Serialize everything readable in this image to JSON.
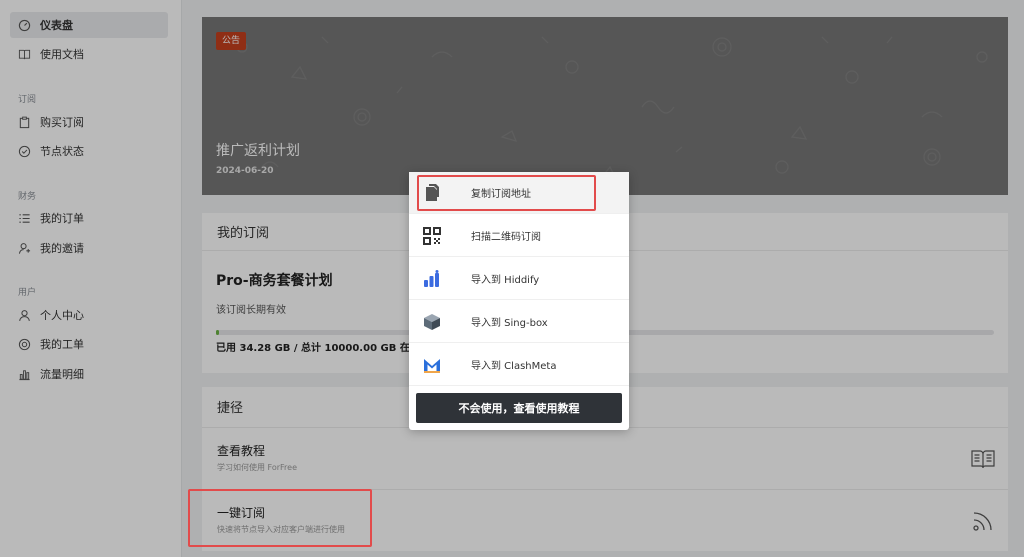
{
  "sidebar": {
    "items": [
      {
        "label": "仪表盘",
        "icon": "dashboard-icon"
      },
      {
        "label": "使用文档",
        "icon": "book-icon"
      },
      {
        "label": "购买订阅",
        "icon": "clipboard-icon"
      },
      {
        "label": "节点状态",
        "icon": "check-circle-icon"
      },
      {
        "label": "我的订单",
        "icon": "list-icon"
      },
      {
        "label": "我的邀请",
        "icon": "invite-icon"
      },
      {
        "label": "个人中心",
        "icon": "user-icon"
      },
      {
        "label": "我的工单",
        "icon": "ticket-icon"
      },
      {
        "label": "流量明细",
        "icon": "bar-chart-icon"
      }
    ],
    "sections": [
      "订阅",
      "财务",
      "用户"
    ]
  },
  "banner": {
    "badge": "公告",
    "title": "推广返利计划",
    "date": "2024-06-20"
  },
  "subscription": {
    "heading": "我的订阅",
    "plan": "Pro-商务套餐计划",
    "validity": "该订阅长期有效",
    "usage_text": "已用 34.28 GB / 总计 10000.00 GB 在线设",
    "usage_fraction": 0.0034
  },
  "shortcuts": {
    "heading": "捷径",
    "items": [
      {
        "title": "查看教程",
        "subtitle": "学习如何使用 ForFree",
        "icon": "book-open-icon"
      },
      {
        "title": "一键订阅",
        "subtitle": "快速将节点导入对应客户端进行使用",
        "icon": "rss-icon"
      }
    ]
  },
  "subscribe_menu": {
    "items": [
      {
        "label": "复制订阅地址",
        "icon": "copy-icon"
      },
      {
        "label": "扫描二维码订阅",
        "icon": "qr-code-icon"
      },
      {
        "label": "导入到 Hiddify",
        "icon": "hiddify-icon"
      },
      {
        "label": "导入到 Sing-box",
        "icon": "sing-box-icon"
      },
      {
        "label": "导入到 ClashMeta",
        "icon": "clashmeta-icon"
      }
    ],
    "tutorial_button": "不会使用，查看使用教程"
  },
  "colors": {
    "badge": "#c4401e",
    "progress_fill": "#6bb344",
    "highlight": "#e24b4b",
    "button_dark": "#2f3338"
  }
}
